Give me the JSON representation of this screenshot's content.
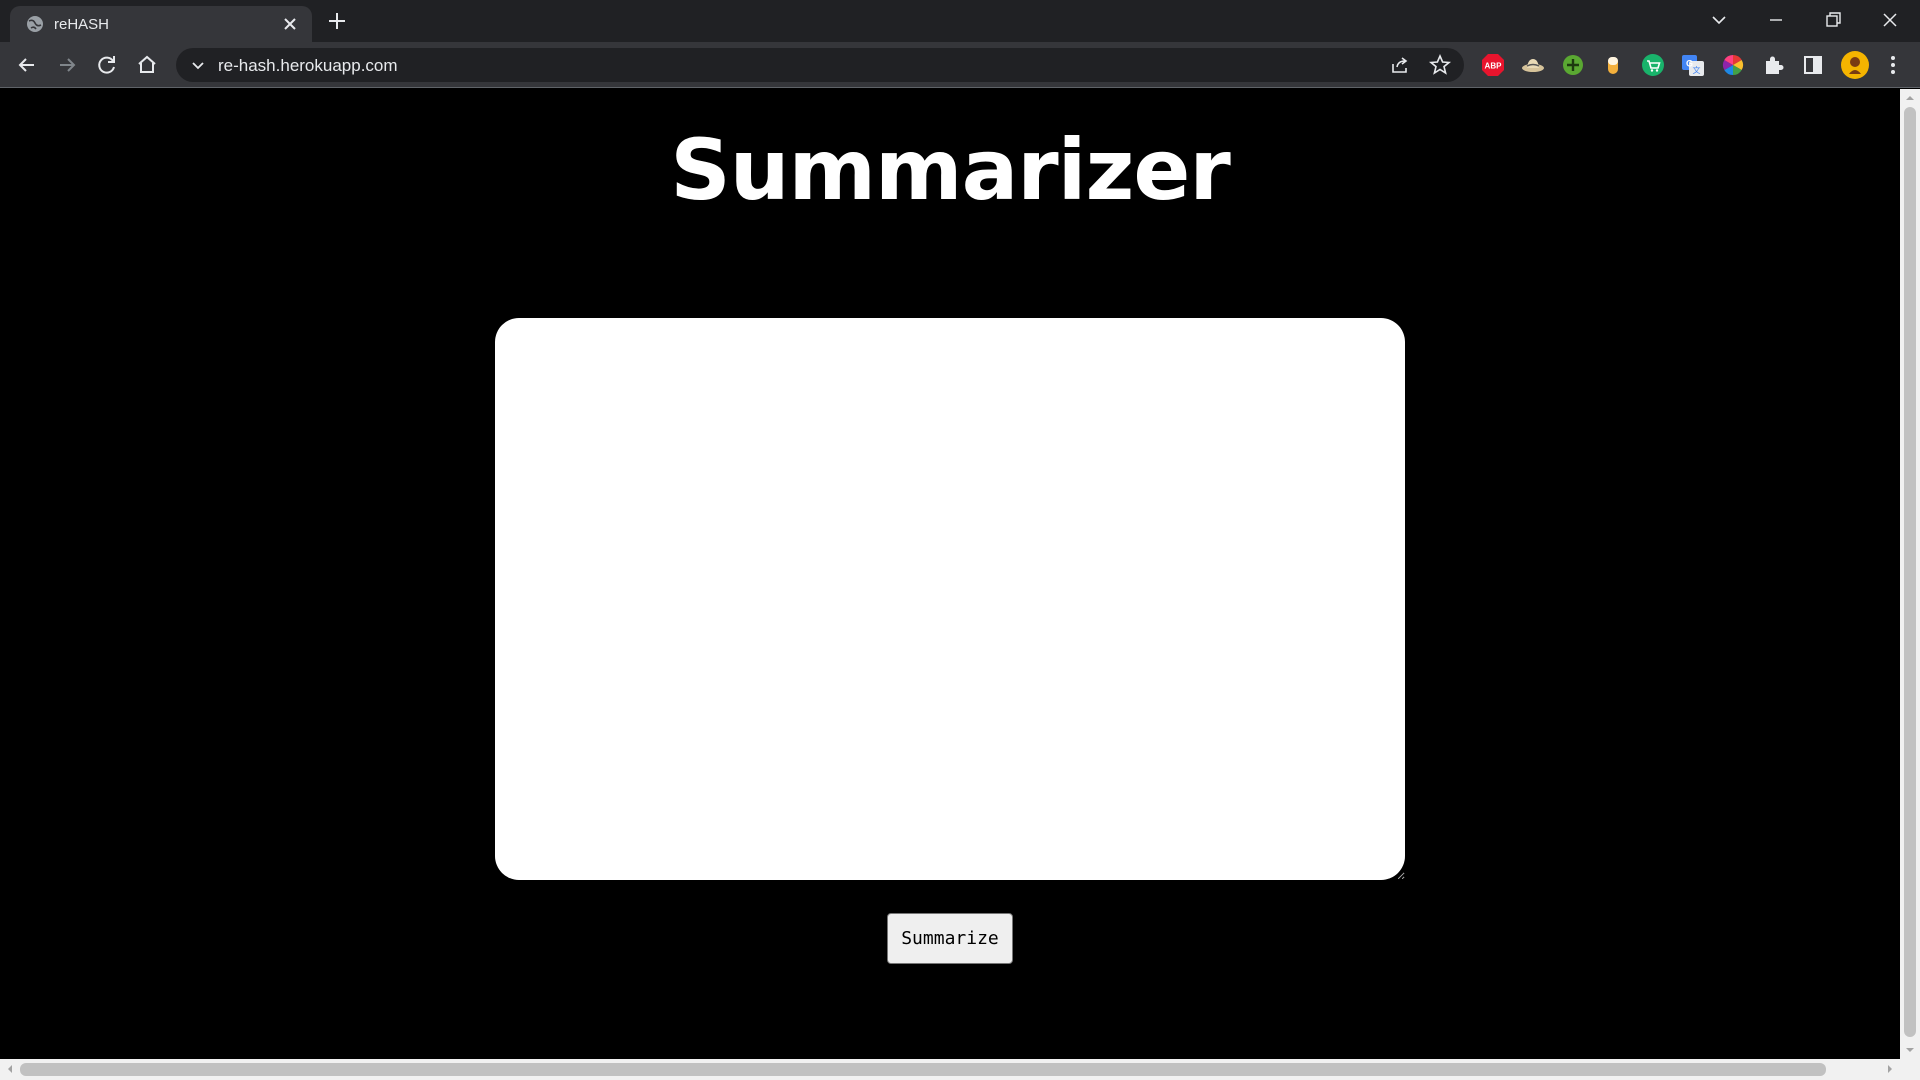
{
  "browser": {
    "tab_title": "reHASH",
    "url": "re-hash.herokuapp.com",
    "extensions": [
      "adblock-plus-icon",
      "hat-icon",
      "green-plus-icon",
      "drop-icon",
      "cart-icon",
      "translate-icon",
      "color-wheel-icon",
      "extensions-puzzle-icon",
      "side-panel-icon",
      "profile-avatar-icon"
    ]
  },
  "page": {
    "title": "Summarizer",
    "textarea_value": "",
    "button_label": "Summarize"
  }
}
